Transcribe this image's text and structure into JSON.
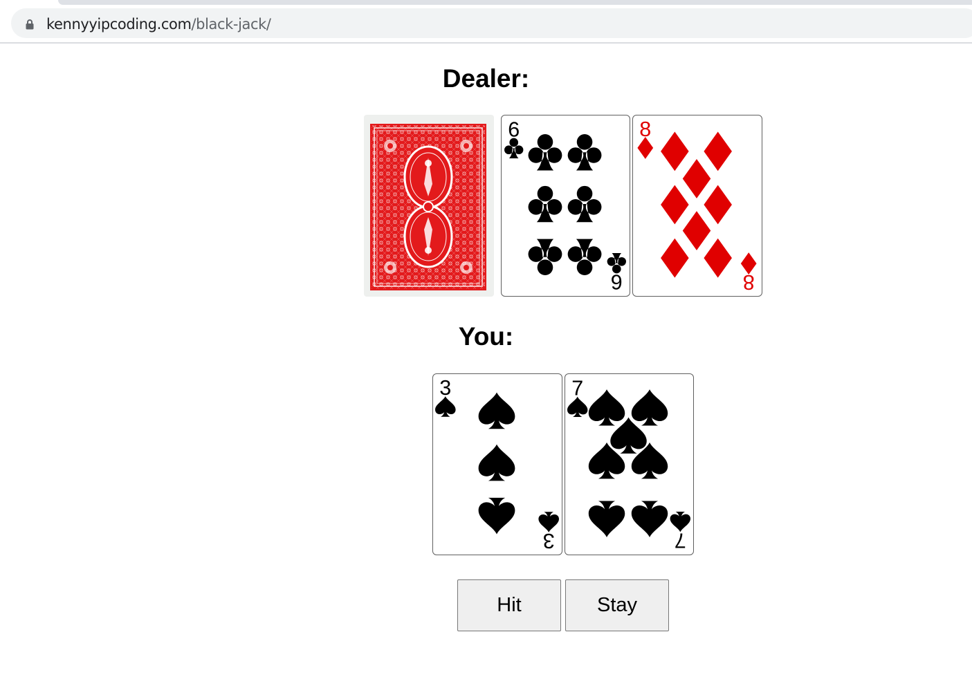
{
  "browser": {
    "url_host": "kennyyipcoding.com",
    "url_path": "/black-jack/"
  },
  "dealer": {
    "heading": "Dealer:",
    "cards": [
      {
        "face_down": true,
        "back_color": "#e31a1c"
      },
      {
        "rank": "6",
        "suit": "clubs",
        "color": "#000000"
      },
      {
        "rank": "8",
        "suit": "diamonds",
        "color": "#e00000"
      }
    ]
  },
  "player": {
    "heading": "You:",
    "cards": [
      {
        "rank": "3",
        "suit": "spades",
        "color": "#000000"
      },
      {
        "rank": "7",
        "suit": "spades",
        "color": "#000000"
      }
    ]
  },
  "controls": {
    "hit_label": "Hit",
    "stay_label": "Stay"
  }
}
